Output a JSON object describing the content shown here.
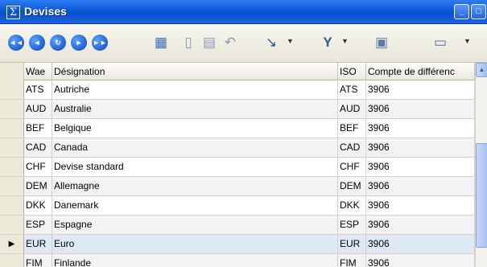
{
  "window": {
    "title": "Devises",
    "app_icon": "Σ",
    "minimize_glyph": "_",
    "maximize_glyph": "□",
    "close_glyph": "×"
  },
  "toolbar": {
    "nav_first": "◄◄",
    "nav_prev": "◄",
    "nav_refresh": "↻",
    "nav_next": "►",
    "nav_last": "►►",
    "icons": {
      "grid_view": "▦",
      "new": "▯",
      "save": "▤",
      "undo": "↶",
      "pointer": "↘",
      "filter": "Y",
      "export": "▣",
      "print": "▭"
    },
    "dropdown_glyph": "▼"
  },
  "grid": {
    "headers": [
      "Wae",
      "Désignation",
      "ISO",
      "Compte de différenc"
    ],
    "rows": [
      {
        "code": "ATS",
        "designation": "Autriche",
        "iso": "ATS",
        "compte": "3906"
      },
      {
        "code": "AUD",
        "designation": "Australie",
        "iso": "AUD",
        "compte": "3906"
      },
      {
        "code": "BEF",
        "designation": "Belgique",
        "iso": "BEF",
        "compte": "3906"
      },
      {
        "code": "CAD",
        "designation": "Canada",
        "iso": "CAD",
        "compte": "3906"
      },
      {
        "code": "CHF",
        "designation": "Devise standard",
        "iso": "CHF",
        "compte": "3906"
      },
      {
        "code": "DEM",
        "designation": "Allemagne",
        "iso": "DEM",
        "compte": "3906"
      },
      {
        "code": "DKK",
        "designation": "Danemark",
        "iso": "DKK",
        "compte": "3906"
      },
      {
        "code": "ESP",
        "designation": "Espagne",
        "iso": "ESP",
        "compte": "3906"
      },
      {
        "code": "EUR",
        "designation": "Euro",
        "iso": "EUR",
        "compte": "3906"
      },
      {
        "code": "FIM",
        "designation": "Finlande",
        "iso": "FIM",
        "compte": "3906"
      }
    ],
    "current_row_indicator": "▶",
    "selected_row_code": "EUR"
  },
  "scrollbar": {
    "up_glyph": "▲"
  }
}
